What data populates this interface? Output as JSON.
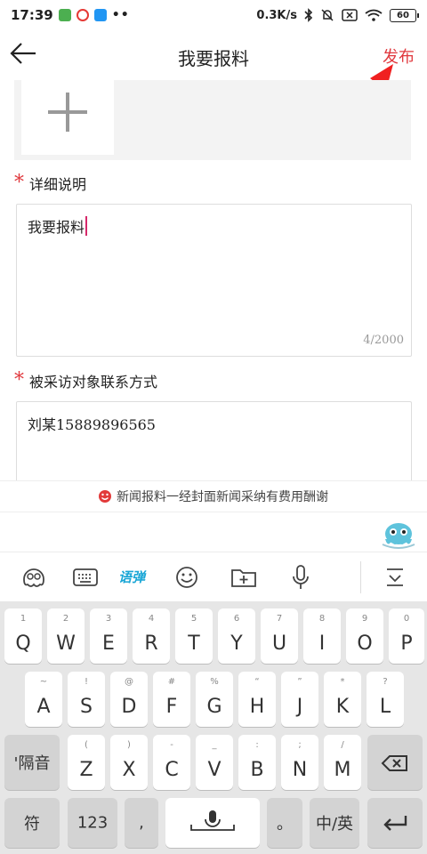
{
  "status": {
    "time": "17:39",
    "speed": "0.3K/s",
    "battery": "60",
    "dots": "••"
  },
  "nav": {
    "title": "我要报料",
    "publish": "发布"
  },
  "form": {
    "detail_label": "详细说明",
    "detail_value": "我要报料",
    "detail_counter": "4/2000",
    "contact_label": "被采访对象联系方式",
    "contact_value": "刘某15889896565"
  },
  "notice": "新闻报料一经封面新闻采纳有费用酬谢",
  "toolbar": {
    "items": [
      "mascot-icon",
      "keyboard-icon",
      "yudan-icon",
      "emoji-icon",
      "folder-icon",
      "mic-icon",
      "collapse-icon"
    ],
    "yudan_label": "语弹"
  },
  "keyboard": {
    "row1": [
      {
        "k": "Q",
        "s": "1"
      },
      {
        "k": "W",
        "s": "2"
      },
      {
        "k": "E",
        "s": "3"
      },
      {
        "k": "R",
        "s": "4"
      },
      {
        "k": "T",
        "s": "5"
      },
      {
        "k": "Y",
        "s": "6"
      },
      {
        "k": "U",
        "s": "7"
      },
      {
        "k": "I",
        "s": "8"
      },
      {
        "k": "O",
        "s": "9"
      },
      {
        "k": "P",
        "s": "0"
      }
    ],
    "row2": [
      {
        "k": "A",
        "s": "~"
      },
      {
        "k": "S",
        "s": "!"
      },
      {
        "k": "D",
        "s": "@"
      },
      {
        "k": "F",
        "s": "#"
      },
      {
        "k": "G",
        "s": "%"
      },
      {
        "k": "H",
        "s": "“"
      },
      {
        "k": "J",
        "s": "”"
      },
      {
        "k": "K",
        "s": "*"
      },
      {
        "k": "L",
        "s": "?"
      }
    ],
    "row3": [
      {
        "k": "Z",
        "s": "("
      },
      {
        "k": "X",
        "s": ")"
      },
      {
        "k": "C",
        "s": "-"
      },
      {
        "k": "V",
        "s": "_"
      },
      {
        "k": "B",
        "s": ":"
      },
      {
        "k": "N",
        "s": ";"
      },
      {
        "k": "M",
        "s": "/"
      }
    ],
    "separator": "'隔音",
    "fu": "符",
    "num": "123",
    "comma": ",",
    "period": "。",
    "lang": "中/英"
  }
}
